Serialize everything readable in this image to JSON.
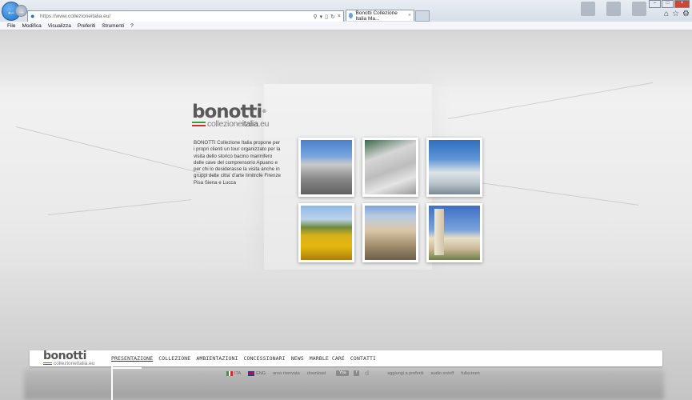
{
  "browser": {
    "url": "https://www.collezioneitalia.eu/",
    "tab_title": "Bonotti Collezione Italia Ma...",
    "menu": [
      "File",
      "Modifica",
      "Visualizza",
      "Preferiti",
      "Strumenti",
      "?"
    ]
  },
  "logo": {
    "word": "bonotti",
    "sub_light": "collezione",
    "sub_bold": "italia",
    "sub_ext": ".eu",
    "flag_colors": [
      "#3a9b3a",
      "#ffffff",
      "#d32b2b"
    ]
  },
  "intro_text": "BONOTTI Collezione Italia  propone per i propri clienti un tour organizzato per la visita dello storico bacino marmifero delle cave del comprensorio Apuano e per chi lo desiderasse la visita anche in gruppi delle citta' d'arte limitrofe Firenze Pisa Siena e Lucca",
  "photos": [
    {
      "subject": "apuan-alps-quarry"
    },
    {
      "subject": "marble-quarry-steps"
    },
    {
      "subject": "marble-quarry-blocks"
    },
    {
      "subject": "sunflower-field"
    },
    {
      "subject": "florence-duomo"
    },
    {
      "subject": "pisa-leaning-tower"
    }
  ],
  "navbar": {
    "logo_word": "bonotti",
    "logo_sub": "collezioneitalia.eu",
    "links": [
      "PRESENTAZIONE",
      "COLLEZIONE",
      "AMBIENTAZIONI",
      "CONCESSIONARI",
      "NEWS",
      "MARBLE CARE",
      "CONTATTI"
    ],
    "active": "PRESENTAZIONE"
  },
  "subfooter": {
    "lang_ita": "ITA",
    "lang_eng": "ENG",
    "area_riservata": "area riservata",
    "download": "download",
    "youtube": "You",
    "aggiungi": "aggiungi a preferiti",
    "audio": "audio on/off",
    "fullscreen": "fullscreen"
  }
}
